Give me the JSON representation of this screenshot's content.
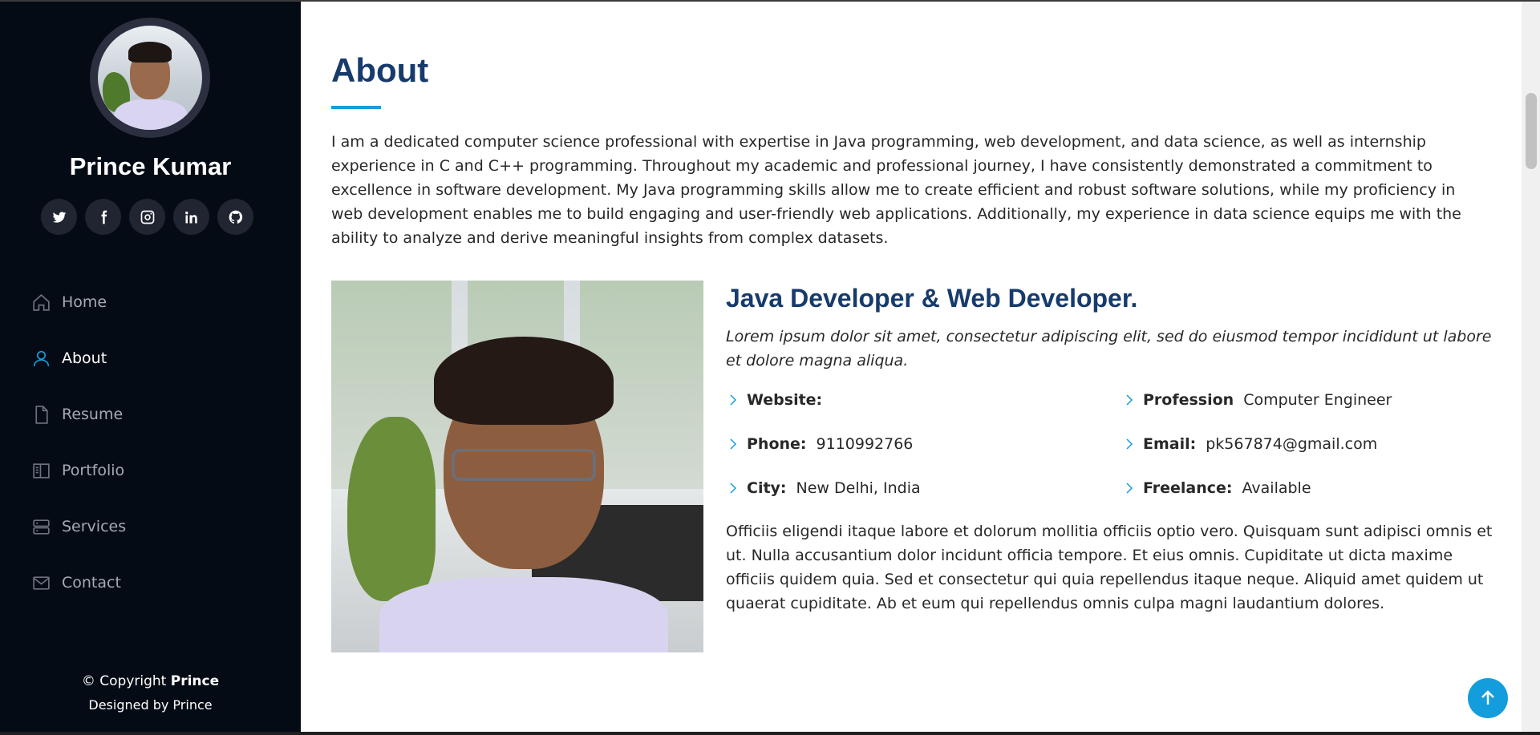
{
  "profile": {
    "name": "Prince Kumar",
    "socials": [
      {
        "icon": "twitter-icon"
      },
      {
        "icon": "facebook-icon"
      },
      {
        "icon": "instagram-icon"
      },
      {
        "icon": "linkedin-icon"
      },
      {
        "icon": "github-icon"
      }
    ]
  },
  "nav": {
    "items": [
      {
        "label": "Home",
        "icon": "home-icon",
        "active": false
      },
      {
        "label": "About",
        "icon": "person-icon",
        "active": true
      },
      {
        "label": "Resume",
        "icon": "file-icon",
        "active": false
      },
      {
        "label": "Portfolio",
        "icon": "book-icon",
        "active": false
      },
      {
        "label": "Services",
        "icon": "server-icon",
        "active": false
      },
      {
        "label": "Contact",
        "icon": "envelope-icon",
        "active": false
      }
    ]
  },
  "footer": {
    "copyright_prefix": "© Copyright ",
    "copyright_name": "Prince",
    "designed": "Designed by Prince"
  },
  "about": {
    "title": "About",
    "intro": "I am a dedicated computer science professional with expertise in Java programming, web development, and data science, as well as internship experience in C and C++ programming. Throughout my academic and professional journey, I have consistently demonstrated a commitment to excellence in software development. My Java programming skills allow me to create efficient and robust software solutions, while my proficiency in web development enables me to build engaging and user-friendly web applications. Additionally, my experience in data science equips me with the ability to analyze and derive meaningful insights from complex datasets.",
    "heading": "Java Developer & Web Developer.",
    "lead": "Lorem ipsum dolor sit amet, consectetur adipiscing elit, sed do eiusmod tempor incididunt ut labore et dolore magna aliqua.",
    "facts": {
      "website": {
        "key": "Website:",
        "value": ""
      },
      "profession": {
        "key": "Profession",
        "value": "Computer Engineer"
      },
      "phone": {
        "key": "Phone:",
        "value": "9110992766"
      },
      "email": {
        "key": "Email:",
        "value": "pk567874@gmail.com"
      },
      "city": {
        "key": "City:",
        "value": "New Delhi, India"
      },
      "freelance": {
        "key": "Freelance:",
        "value": "Available"
      }
    },
    "description": "Officiis eligendi itaque labore et dolorum mollitia officiis optio vero. Quisquam sunt adipisci omnis et ut. Nulla accusantium dolor incidunt officia tempore. Et eius omnis. Cupiditate ut dicta maxime officiis quidem quia. Sed et consectetur qui quia repellendus itaque neque. Aliquid amet quidem ut quaerat cupiditate. Ab et eum qui repellendus omnis culpa magni laudantium dolores."
  },
  "colors": {
    "accent": "#149ddd",
    "heading": "#173b6c",
    "sidebar_bg": "#040b14"
  }
}
